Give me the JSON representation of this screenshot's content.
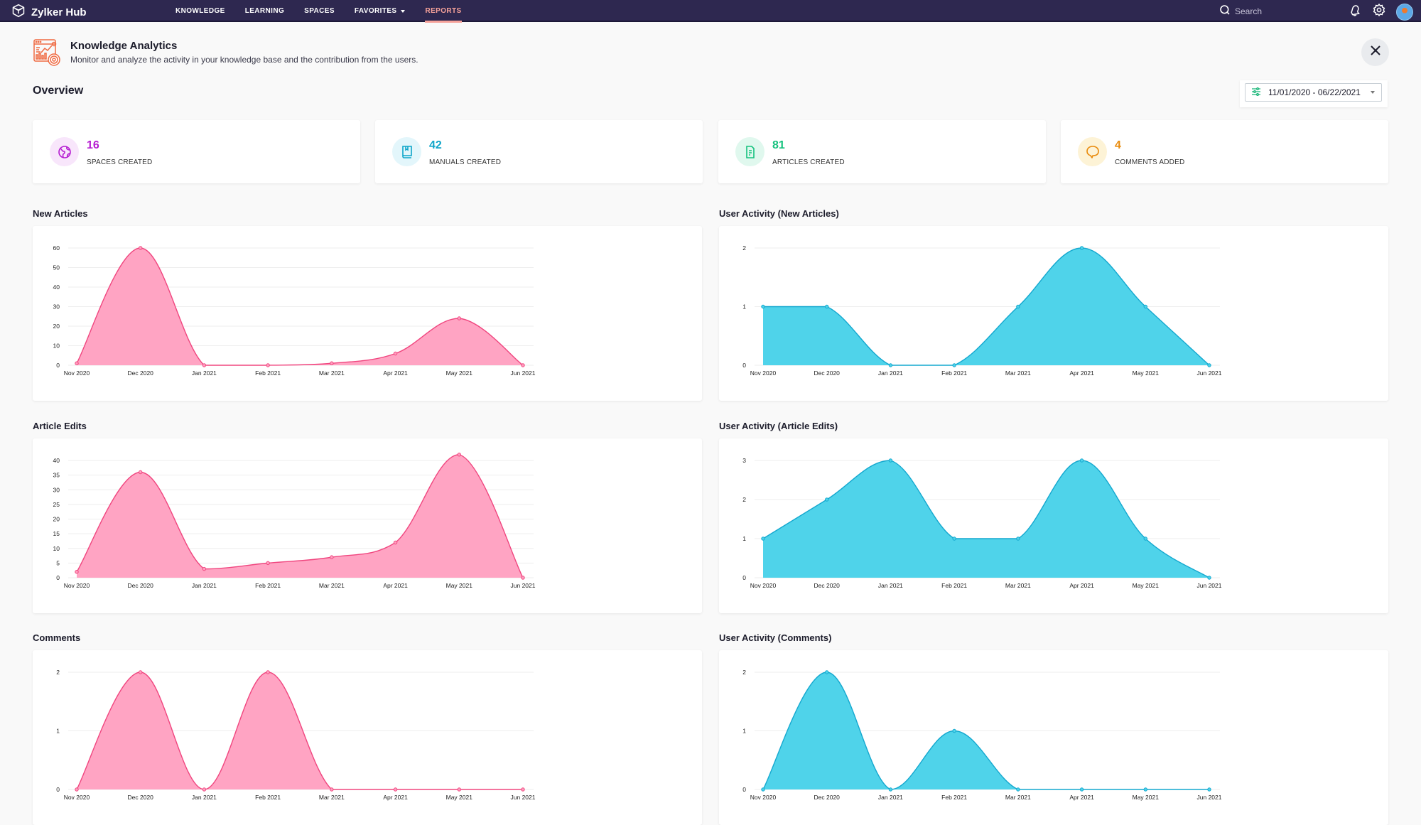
{
  "app": {
    "brand": "Zylker Hub",
    "nav": [
      {
        "label": "KNOWLEDGE",
        "active": false
      },
      {
        "label": "LEARNING",
        "active": false
      },
      {
        "label": "SPACES",
        "active": false
      },
      {
        "label": "FAVORITES",
        "active": false,
        "dropdown": true
      },
      {
        "label": "REPORTS",
        "active": true
      }
    ],
    "search_placeholder": "Search",
    "icons": [
      "bell-icon",
      "gear-icon",
      "avatar"
    ]
  },
  "header": {
    "title": "Knowledge Analytics",
    "subtitle": "Monitor and analyze the activity in your knowledge base and the contribution from the users.",
    "section": "Overview",
    "date_range": "11/01/2020 - 06/22/2021"
  },
  "stats": [
    {
      "value": "16",
      "label": "SPACES CREATED",
      "color": "#b51cd1",
      "bg": "#f8e6fb",
      "icon": "spaces-icon"
    },
    {
      "value": "42",
      "label": "MANUALS CREATED",
      "color": "#0ea5c9",
      "bg": "#e3f6fb",
      "icon": "manual-icon"
    },
    {
      "value": "81",
      "label": "ARTICLES CREATED",
      "color": "#15c27e",
      "bg": "#e0f8ee",
      "icon": "article-icon"
    },
    {
      "value": "4",
      "label": "COMMENTS ADDED",
      "color": "#e98b0c",
      "bg": "#fdf3d6",
      "icon": "comment-icon"
    }
  ],
  "colors": {
    "pink_fill": "#ff9fc0",
    "pink_line": "#f0467f",
    "cyan_fill": "#4fd3ea",
    "cyan_line": "#14a8cf"
  },
  "chart_data": [
    {
      "type": "area",
      "title": "New Articles",
      "theme": "pink",
      "categories": [
        "Nov 2020",
        "Dec 2020",
        "Jan 2021",
        "Feb 2021",
        "Mar 2021",
        "Apr 2021",
        "May 2021",
        "Jun 2021"
      ],
      "values": [
        1,
        60,
        0,
        0,
        1,
        6,
        24,
        0
      ],
      "yticks": [
        0,
        10,
        20,
        30,
        40,
        50,
        60
      ],
      "ylim": [
        0,
        60
      ],
      "grid": true
    },
    {
      "type": "area",
      "title": "User Activity (New Articles)",
      "theme": "cyan",
      "categories": [
        "Nov 2020",
        "Dec 2020",
        "Jan 2021",
        "Feb 2021",
        "Mar 2021",
        "Apr 2021",
        "May 2021",
        "Jun 2021"
      ],
      "values": [
        1,
        1,
        0,
        0,
        1,
        2,
        1,
        0
      ],
      "yticks": [
        0,
        1,
        2
      ],
      "ylim": [
        0,
        2
      ],
      "grid": true
    },
    {
      "type": "area",
      "title": "Article Edits",
      "theme": "pink",
      "categories": [
        "Nov 2020",
        "Dec 2020",
        "Jan 2021",
        "Feb 2021",
        "Mar 2021",
        "Apr 2021",
        "May 2021",
        "Jun 2021"
      ],
      "values": [
        2,
        36,
        3,
        5,
        7,
        12,
        42,
        0
      ],
      "yticks": [
        0,
        5,
        10,
        15,
        20,
        25,
        30,
        35,
        40
      ],
      "ylim": [
        0,
        40
      ],
      "grid": true
    },
    {
      "type": "area",
      "title": "User Activity (Article Edits)",
      "theme": "cyan",
      "categories": [
        "Nov 2020",
        "Dec 2020",
        "Jan 2021",
        "Feb 2021",
        "Mar 2021",
        "Apr 2021",
        "May 2021",
        "Jun 2021"
      ],
      "values": [
        1,
        2,
        3,
        1,
        1,
        3,
        1,
        0
      ],
      "yticks": [
        0,
        1,
        2,
        3
      ],
      "ylim": [
        0,
        3
      ],
      "grid": true
    },
    {
      "type": "area",
      "title": "Comments",
      "theme": "pink",
      "categories": [
        "Nov 2020",
        "Dec 2020",
        "Jan 2021",
        "Feb 2021",
        "Mar 2021",
        "Apr 2021",
        "May 2021",
        "Jun 2021"
      ],
      "values": [
        0,
        2,
        0,
        2,
        0,
        0,
        0,
        0
      ],
      "yticks": [
        0,
        1,
        2
      ],
      "ylim": [
        0,
        2
      ],
      "grid": true
    },
    {
      "type": "area",
      "title": "User Activity (Comments)",
      "theme": "cyan",
      "categories": [
        "Nov 2020",
        "Dec 2020",
        "Jan 2021",
        "Feb 2021",
        "Mar 2021",
        "Apr 2021",
        "May 2021",
        "Jun 2021"
      ],
      "values": [
        0,
        2,
        0,
        1,
        0,
        0,
        0,
        0
      ],
      "yticks": [
        0,
        1,
        2
      ],
      "ylim": [
        0,
        2
      ],
      "grid": true
    }
  ]
}
